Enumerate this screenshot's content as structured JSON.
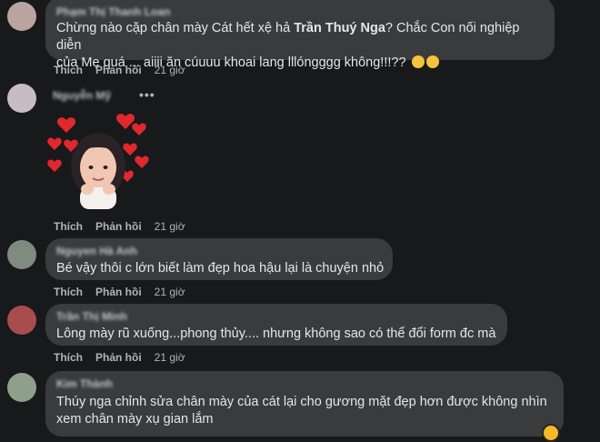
{
  "comments": [
    {
      "author": "Phạm Thị Thanh Loan",
      "text_prefix": "Chừng nào cặp chân mày Cát hết xệ hả ",
      "mention": "Trần Thuý Nga",
      "text_suffix_line1": "? Chắc Con nối nghiệp diễn",
      "text_line2": "của Mẹ quá ... aiiii ăn cúuuu khoai lang lllóngggg không!!!??",
      "like": "Thích",
      "reply": "Phản hồi",
      "time": "21 giờ",
      "avatar_color": "#b9a4a0"
    },
    {
      "author": "Nguyễn Mỹ",
      "sticker": "heart-girl-sticker",
      "like": "Thích",
      "reply": "Phản hồi",
      "time": "21 giờ",
      "avatar_color": "#c7bcc4"
    },
    {
      "author": "Nguyen Hà Anh",
      "text": "Bé vậy thôi c lớn biết làm đẹp hoa hậu lại là chuyện nhỏ",
      "like": "Thích",
      "reply": "Phản hồi",
      "time": "21 giờ",
      "avatar_color": "#7f8a80"
    },
    {
      "author": "Trần Thị Minh",
      "text": "Lông mày rũ xuống...phong thủy.... nhưng không sao có thể đổi form đc mà",
      "like": "Thích",
      "reply": "Phản hồi",
      "time": "21 giờ",
      "avatar_color": "#a84c4e"
    },
    {
      "author": "Kim Thành",
      "text_line1": "Thúy nga chỉnh sửa chân mày của cát lại cho gương mặt đẹp hơn được không nhìn",
      "text_line2": "xem chân mày xụ gian lắm",
      "avatar_color": "#8fa08a"
    }
  ],
  "colors": {
    "background": "#18191a",
    "bubble": "#3a3b3c",
    "text": "#e4e6eb",
    "meta": "#b0b3b8",
    "heart": "#e0282e"
  }
}
